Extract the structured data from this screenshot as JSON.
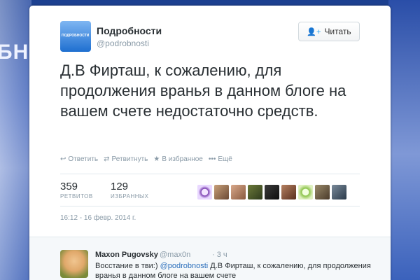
{
  "background": {
    "partial_text": "БНО"
  },
  "tweet": {
    "avatar_text": "ПОДРОБНОСТИ",
    "name": "Подробности",
    "handle": "@podrobnosti",
    "follow_label": "Читать",
    "text": "Д.В Фирташ, к сожалению, для продолжения вранья в данном блоге на вашем счете недостаточно средств.",
    "actions": {
      "reply": "Ответить",
      "retweet": "Ретвитнуть",
      "favorite": "В избранное",
      "more": "Ещё"
    },
    "stats": {
      "retweets_count": "359",
      "retweets_label": "РЕТВИТОВ",
      "favorites_count": "129",
      "favorites_label": "ИЗБРАННЫХ"
    },
    "timestamp": "16:12 - 16 февр. 2014 г."
  },
  "reply": {
    "name": "Maxon Pugovsky",
    "handle": "@max0n",
    "time": "· 3 ч",
    "prefix": "Восстание в тви:)",
    "mention": "@podrobnosti",
    "text": " Д.В Фирташ, к сожалению, для продолжения вранья в данном блоге на вашем счете"
  },
  "colors": {
    "accent": "#2aa3ef",
    "link": "#2a6ebb"
  }
}
